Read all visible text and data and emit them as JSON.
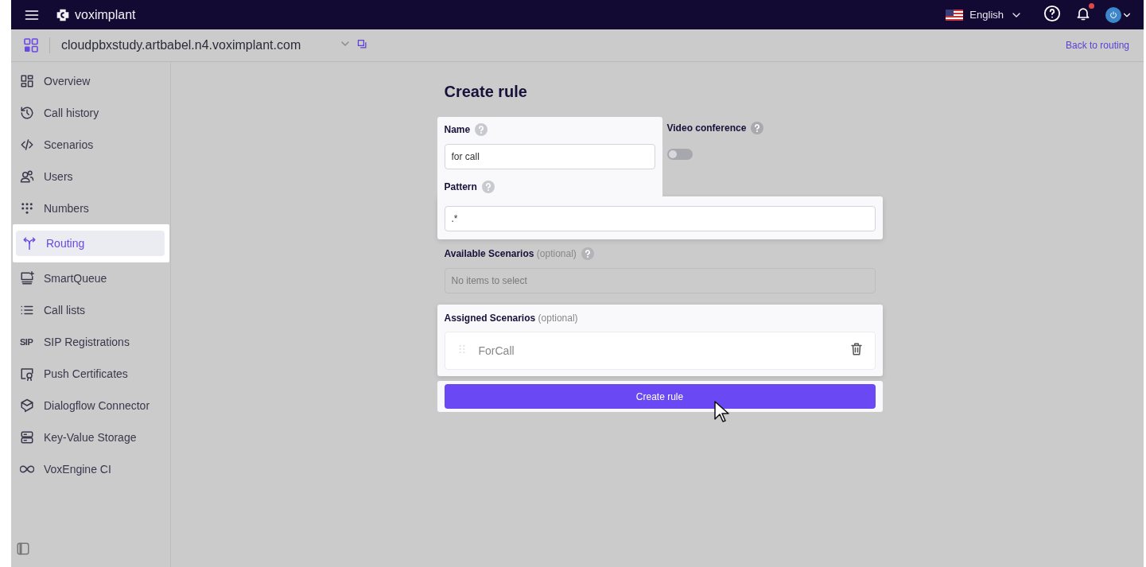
{
  "header": {
    "logo": "voximplant",
    "language": "English",
    "notifications_unread": true
  },
  "app_bar": {
    "domain": "cloudpbxstudy.artbabel.n4.voximplant.com",
    "back_link": "Back to routing"
  },
  "sidebar": {
    "items": [
      {
        "label": "Overview",
        "selected": false
      },
      {
        "label": "Call history",
        "selected": false
      },
      {
        "label": "Scenarios",
        "selected": false
      },
      {
        "label": "Users",
        "selected": false
      },
      {
        "label": "Numbers",
        "selected": false
      },
      {
        "label": "Routing",
        "selected": true
      },
      {
        "label": "SmartQueue",
        "selected": false
      },
      {
        "label": "Call lists",
        "selected": false
      },
      {
        "label": "SIP Registrations",
        "selected": false,
        "icon_text": "SIP"
      },
      {
        "label": "Push Certificates",
        "selected": false
      },
      {
        "label": "Dialogflow Connector",
        "selected": false
      },
      {
        "label": "Key-Value Storage",
        "selected": false
      },
      {
        "label": "VoxEngine CI",
        "selected": false
      }
    ]
  },
  "form": {
    "title": "Create rule",
    "name": {
      "label": "Name",
      "value": "for call"
    },
    "video_conference": {
      "label": "Video conference",
      "on": false
    },
    "pattern": {
      "label": "Pattern",
      "value": ".*"
    },
    "available_scenarios": {
      "label": "Available Scenarios",
      "hint": "(optional)",
      "placeholder": "No items to select"
    },
    "assigned_scenarios": {
      "label": "Assigned Scenarios",
      "hint": "(optional)",
      "items": [
        {
          "name": "ForCall"
        }
      ]
    },
    "submit": "Create rule"
  }
}
